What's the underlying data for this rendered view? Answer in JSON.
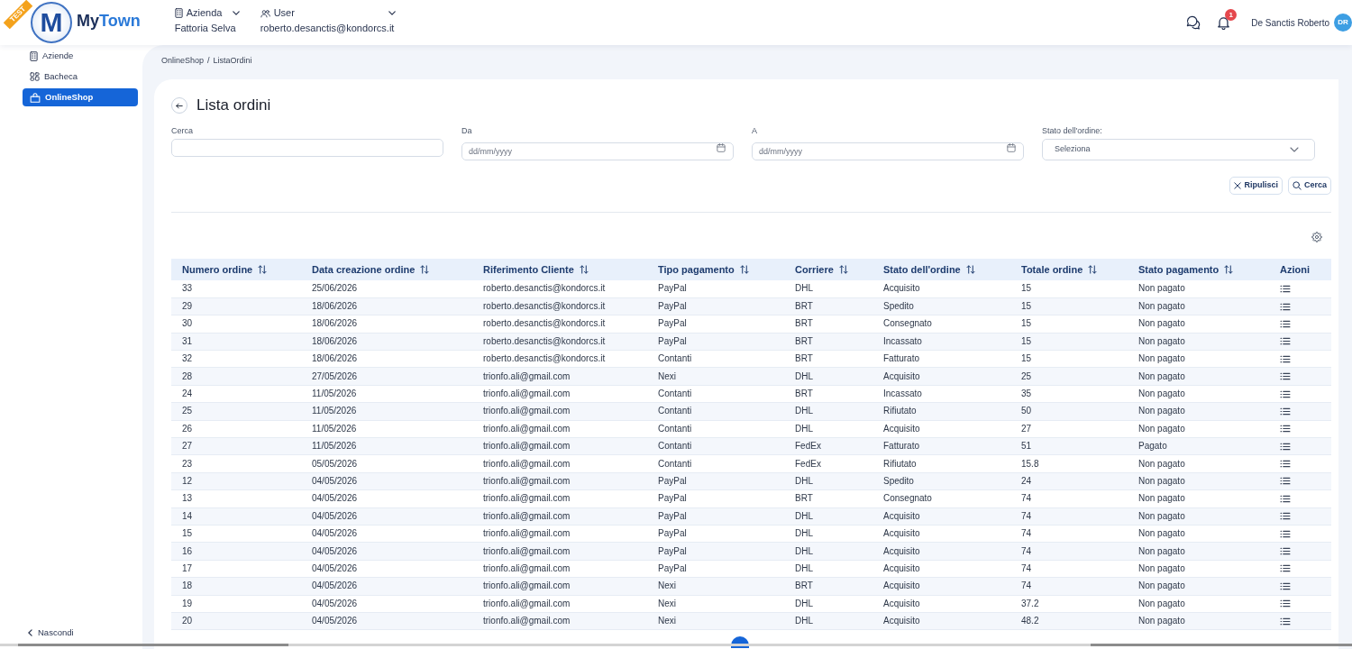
{
  "environment_ribbon": "TEST",
  "logo": {
    "emblem_letter": "M",
    "name_start": "My",
    "name_end": "Town"
  },
  "header": {
    "selectors": [
      {
        "label": "Azienda",
        "value": "Fattoria Selva"
      },
      {
        "label": "User",
        "value": "roberto.desanctis@kondorcs.it"
      }
    ],
    "notification_count": "1",
    "user_name": "De Sanctis Roberto",
    "avatar_initials": "DR"
  },
  "sidebar": {
    "items": [
      {
        "label": "Aziende",
        "selected": false
      },
      {
        "label": "Bacheca",
        "selected": false
      },
      {
        "label": "OnlineShop",
        "selected": true
      }
    ],
    "collapse_label": "Nascondi"
  },
  "breadcrumb": {
    "items": [
      "OnlineShop",
      "ListaOrdini"
    ],
    "separator": "/"
  },
  "page_title": "Lista ordini",
  "filters": [
    {
      "kind": "text",
      "label": "Cerca"
    },
    {
      "kind": "date",
      "label": "Da",
      "placeholder": "dd/mm/yyyy"
    },
    {
      "kind": "date",
      "label": "A",
      "placeholder": "dd/mm/yyyy"
    },
    {
      "kind": "select",
      "label": "Stato dell'ordine:",
      "placeholder": "Seleziona"
    }
  ],
  "filter_actions": [
    {
      "kind": "clear",
      "label": "Ripulisci"
    },
    {
      "kind": "search",
      "label": "Cerca"
    }
  ],
  "table": {
    "columns": [
      {
        "label": "Numero ordine",
        "sortable": true
      },
      {
        "label": "Data creazione ordine",
        "sortable": true
      },
      {
        "label": "Riferimento Cliente",
        "sortable": true
      },
      {
        "label": "Tipo pagamento",
        "sortable": true
      },
      {
        "label": "Corriere",
        "sortable": true
      },
      {
        "label": "Stato dell'ordine",
        "sortable": true
      },
      {
        "label": "Totale ordine",
        "sortable": true
      },
      {
        "label": "Stato pagamento",
        "sortable": true
      },
      {
        "label": "Azioni",
        "sortable": false
      }
    ],
    "rows": [
      [
        "33",
        "25/06/2026",
        "roberto.desanctis@kondorcs.it",
        "PayPal",
        "DHL",
        "Acquisito",
        "15",
        "Non pagato"
      ],
      [
        "29",
        "18/06/2026",
        "roberto.desanctis@kondorcs.it",
        "PayPal",
        "BRT",
        "Spedito",
        "15",
        "Non pagato"
      ],
      [
        "30",
        "18/06/2026",
        "roberto.desanctis@kondorcs.it",
        "PayPal",
        "BRT",
        "Consegnato",
        "15",
        "Non pagato"
      ],
      [
        "31",
        "18/06/2026",
        "roberto.desanctis@kondorcs.it",
        "PayPal",
        "BRT",
        "Incassato",
        "15",
        "Non pagato"
      ],
      [
        "32",
        "18/06/2026",
        "roberto.desanctis@kondorcs.it",
        "Contanti",
        "BRT",
        "Fatturato",
        "15",
        "Non pagato"
      ],
      [
        "28",
        "27/05/2026",
        "trionfo.ali@gmail.com",
        "Nexi",
        "DHL",
        "Acquisito",
        "25",
        "Non pagato"
      ],
      [
        "24",
        "11/05/2026",
        "trionfo.ali@gmail.com",
        "Contanti",
        "BRT",
        "Incassato",
        "35",
        "Non pagato"
      ],
      [
        "25",
        "11/05/2026",
        "trionfo.ali@gmail.com",
        "Contanti",
        "DHL",
        "Rifiutato",
        "50",
        "Non pagato"
      ],
      [
        "26",
        "11/05/2026",
        "trionfo.ali@gmail.com",
        "Contanti",
        "DHL",
        "Acquisito",
        "27",
        "Non pagato"
      ],
      [
        "27",
        "11/05/2026",
        "trionfo.ali@gmail.com",
        "Contanti",
        "FedEx",
        "Fatturato",
        "51",
        "Pagato"
      ],
      [
        "23",
        "05/05/2026",
        "trionfo.ali@gmail.com",
        "Contanti",
        "FedEx",
        "Rifiutato",
        "15.8",
        "Non pagato"
      ],
      [
        "12",
        "04/05/2026",
        "trionfo.ali@gmail.com",
        "PayPal",
        "DHL",
        "Spedito",
        "24",
        "Non pagato"
      ],
      [
        "13",
        "04/05/2026",
        "trionfo.ali@gmail.com",
        "PayPal",
        "BRT",
        "Consegnato",
        "74",
        "Non pagato"
      ],
      [
        "14",
        "04/05/2026",
        "trionfo.ali@gmail.com",
        "PayPal",
        "DHL",
        "Acquisito",
        "74",
        "Non pagato"
      ],
      [
        "15",
        "04/05/2026",
        "trionfo.ali@gmail.com",
        "PayPal",
        "DHL",
        "Acquisito",
        "74",
        "Non pagato"
      ],
      [
        "16",
        "04/05/2026",
        "trionfo.ali@gmail.com",
        "PayPal",
        "DHL",
        "Acquisito",
        "74",
        "Non pagato"
      ],
      [
        "17",
        "04/05/2026",
        "trionfo.ali@gmail.com",
        "PayPal",
        "DHL",
        "Acquisito",
        "74",
        "Non pagato"
      ],
      [
        "18",
        "04/05/2026",
        "trionfo.ali@gmail.com",
        "Nexi",
        "BRT",
        "Acquisito",
        "74",
        "Non pagato"
      ],
      [
        "19",
        "04/05/2026",
        "trionfo.ali@gmail.com",
        "Nexi",
        "DHL",
        "Acquisito",
        "37.2",
        "Non pagato"
      ],
      [
        "20",
        "04/05/2026",
        "trionfo.ali@gmail.com",
        "Nexi",
        "DHL",
        "Acquisito",
        "48.2",
        "Non pagato"
      ]
    ]
  }
}
